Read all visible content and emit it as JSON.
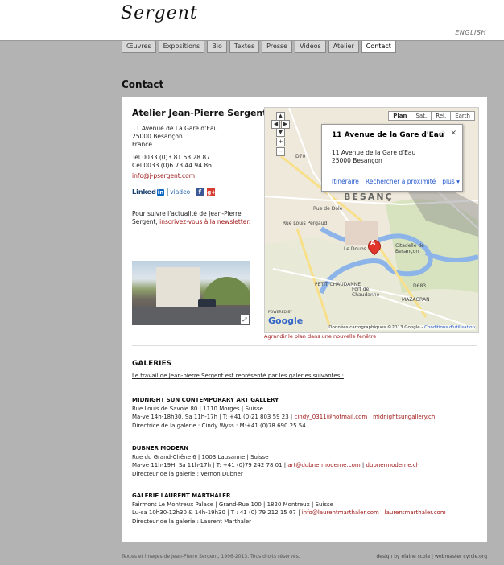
{
  "header": {
    "logo_text": "Sergent",
    "lang_label": "ENGLISH"
  },
  "nav": {
    "tabs": [
      "Œuvres",
      "Expositions",
      "Bio",
      "Textes",
      "Presse",
      "Vidéos",
      "Atelier",
      "Contact"
    ],
    "active": "Contact"
  },
  "page_title": "Contact",
  "atelier": {
    "title": "Atelier Jean-Pierre Sergent",
    "address_line1": "11 Avenue de La Gare d'Eau",
    "address_line2": "25000 Besançon",
    "country": "France",
    "tel": "Tel 0033 (0)3 81 53 28 87",
    "cell": "Cel 0033 (0)6 73 44 94 86",
    "email": "info@j-psergent.com",
    "social": {
      "linkedin_label": "Linked",
      "linkedin_in": "in",
      "viadeo_label": "viadeo",
      "facebook_glyph": "f",
      "googleplus_glyph": "g+"
    },
    "follow_text": "Pour suivre l'actualité de Jean-Pierre Sergent,",
    "follow_link": "inscrivez-vous à la newsletter."
  },
  "map": {
    "types": [
      "Plan",
      "Sat.",
      "Rel.",
      "Earth"
    ],
    "active_type": "Plan",
    "info_title": "11 Avenue de la Gare d'Eau",
    "info_address_line1": "11 Avenue de la Gare d'Eau",
    "info_address_line2": "25000 Besançon",
    "info_links": [
      "Itinéraire",
      "Rechercher à proximité",
      "plus"
    ],
    "pin_letter": "A",
    "city_label": "BESANÇ",
    "labels": [
      "Citadelle de Besançon",
      "Le Doubs",
      "PETIT CHAUDANNE",
      "Fort de Chaudanne",
      "MAZAGRAN",
      "Rue de Dole",
      "Rue Louis Pergaud",
      "D70",
      "D683"
    ],
    "powered_by": "POWERED BY",
    "google_logo": "Google",
    "copyright": "Données cartographiques ©2013 Google -",
    "terms": "Conditions d'utilisation",
    "enlarge_link": "Agrandir le plan dans une nouvelle fenêtre"
  },
  "galleries": {
    "title": "GALERIES",
    "intro": "Le travail de Jean-pierre Sergent est représenté par les galeries suivantes :",
    "items": [
      {
        "name": "MIDNIGHT SUN CONTEMPORARY ART GALLERY",
        "address": "Rue Louis de Savoie 80 | 1110 Morges | Suisse",
        "hours": "Ma-ve 14h-18h30, Sa 11h-17h | T: +41 (0)21 803 59 23 |",
        "email": "cindy_0311@hotmail.com",
        "site": "midnightsungallery.ch",
        "director": "Directrice de la galerie : Cindy Wyss : M:+41 (0)78 690 25 54"
      },
      {
        "name": "DUBNER MODERN",
        "address": "Rue du Grand-Chêne 6 | 1003 Lausanne | Suisse",
        "hours": "Ma-ve 11h-19H, Sa 11h-17h | T: +41 (0)79 242 78 01 |",
        "email": "art@dubnermoderne.com",
        "site": "dubnermoderne.ch",
        "director": "Directeur de la galerie : Vernon Dubner"
      },
      {
        "name": "GALERIE LAURENT MARTHALER",
        "address": "Fairmont Le Montreux Palace | Grand-Rue 100 | 1820 Montreux | Suisse",
        "hours": "Lu-sa 10h30-12h30 & 14h-19h30 | T : 41 (0) 79 212 15 07 |",
        "email": "info@laurentmarthaler.com",
        "site": "laurentmarthaler.com",
        "director": "Directeur de la galerie : Laurent Marthaler"
      }
    ]
  },
  "footer": {
    "left": "Textes et images de Jean-Pierre Sergent, 1996-2013. Tous droits réservés.",
    "design": "design by elaine scola",
    "webmaster": "webmaster cyrcle.org"
  },
  "colors": {
    "background": "#b3b3b3",
    "link_red": "#a01818",
    "map_link_blue": "#2255cc",
    "pin_red": "#e0362c"
  }
}
